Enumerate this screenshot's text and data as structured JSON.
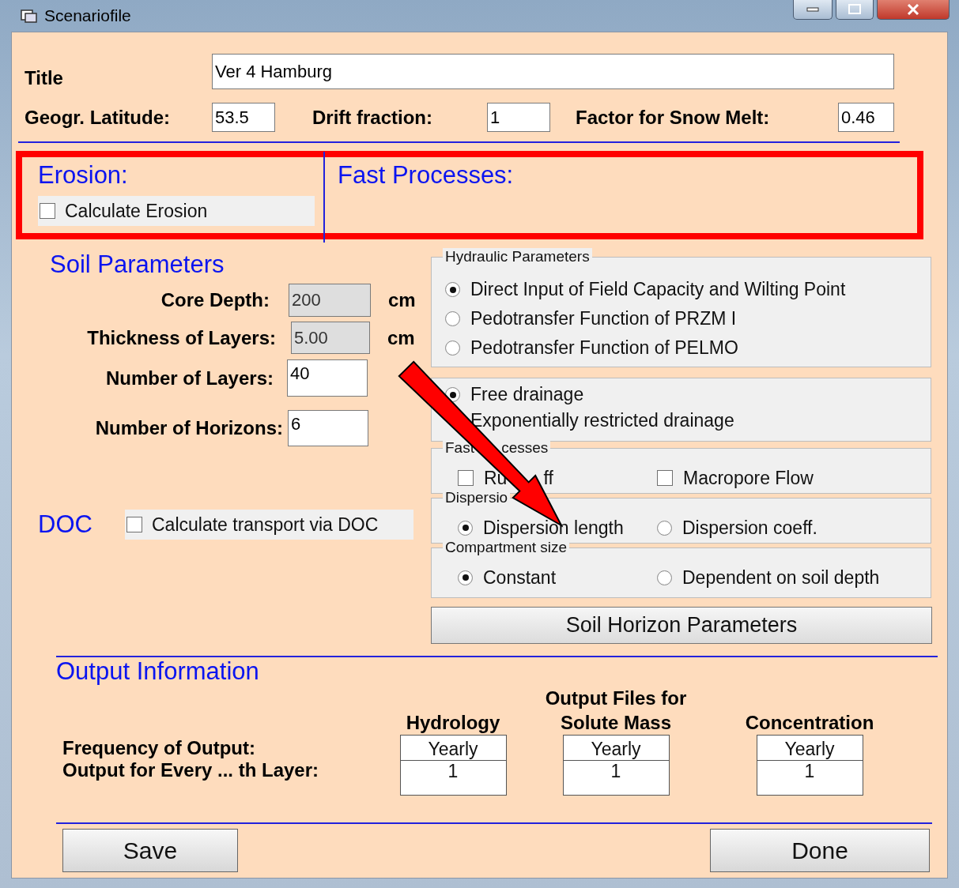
{
  "window": {
    "title": "Scenariofile"
  },
  "general": {
    "title_label": "Title",
    "title_value": "Ver 4 Hamburg",
    "fields": [
      {
        "label": "Geogr. Latitude:",
        "value": "53.5"
      },
      {
        "label": "Drift fraction:",
        "value": "1"
      },
      {
        "label": "Factor for Snow Melt:",
        "value": "0.46"
      }
    ]
  },
  "erosion": {
    "heading": "Erosion:",
    "checkbox": {
      "label": "Calculate Erosion",
      "checked": false
    }
  },
  "fast_processes_heading": "Fast Processes:",
  "soil": {
    "heading": "Soil Parameters",
    "fields": [
      {
        "label": "Core Depth:",
        "value": "200",
        "unit": "cm",
        "disabled": true
      },
      {
        "label": "Thickness of Layers:",
        "value": "5.00",
        "unit": "cm",
        "disabled": true
      },
      {
        "label": "Number of Layers:",
        "value": "40",
        "disabled": false
      },
      {
        "label": "Number of Horizons:",
        "value": "6",
        "disabled": false
      }
    ]
  },
  "doc": {
    "heading": "DOC",
    "checkbox": {
      "label": "Calculate transport via DOC",
      "checked": false
    }
  },
  "groups": [
    {
      "legend": [
        "Hydraulic Parameters"
      ],
      "kind": "radio_list",
      "options": [
        {
          "label": "Direct Input of Field Capacity and Wilting Point",
          "selected": true
        },
        {
          "label": "Pedotransfer Function of PRZM I",
          "selected": false
        },
        {
          "label": "Pedotransfer Function of PELMO",
          "selected": false
        }
      ]
    },
    {
      "kind": "radio_list",
      "options": [
        {
          "label": "Free drainage",
          "selected": true
        },
        {
          "label": "Exponentially restricted drainage"
        }
      ]
    },
    {
      "legend": [
        "Fast",
        "cesses"
      ],
      "kind": "checkbox_row",
      "options": [
        {
          "label": [
            "Ru",
            "ff"
          ],
          "checked": false
        },
        {
          "label": "Macropore Flow",
          "checked": false
        }
      ]
    },
    {
      "legend": [
        "Dispersio"
      ],
      "kind": "radio_row",
      "options": [
        {
          "label": "Dispersion length",
          "selected": true
        },
        {
          "label": "Dispersion coeff.",
          "selected": false
        }
      ]
    },
    {
      "legend": [
        "Compartment size"
      ],
      "kind": "radio_row",
      "options": [
        {
          "label": "Constant",
          "selected": true
        },
        {
          "label": "Dependent on soil depth",
          "selected": false
        }
      ]
    }
  ],
  "soil_horizon_button": "Soil Horizon Parameters",
  "output": {
    "heading": "Output Information",
    "row_labels": [
      "Frequency of Output:",
      "Output for Every  ... th Layer:"
    ],
    "columns": [
      {
        "header": "Hydrology",
        "frequency": "Yearly",
        "layer": "1"
      },
      {
        "header": "Output Files for Solute Mass",
        "frequency": "Yearly",
        "layer": "1"
      },
      {
        "header": "Concentration",
        "frequency": "Yearly",
        "layer": "1"
      }
    ]
  },
  "buttons": [
    "Save",
    "Done"
  ]
}
